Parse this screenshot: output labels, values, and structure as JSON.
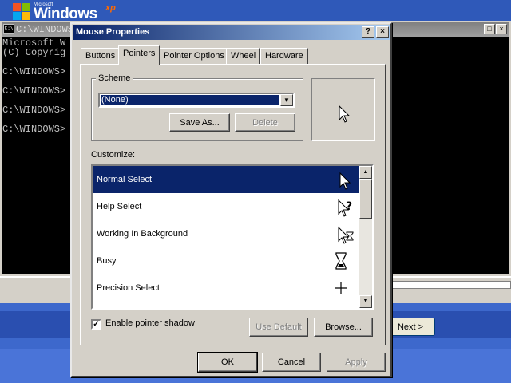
{
  "setup": {
    "logo_microsoft": "Microsoft",
    "logo_windows": "Windows",
    "logo_xp": "xp",
    "next_label": "Next >"
  },
  "cmd": {
    "title": "C:\\WINDOWS",
    "lines": [
      "Microsoft W",
      "(C) Copyrig",
      "",
      "C:\\WINDOWS>",
      "",
      "C:\\WINDOWS>",
      "",
      "C:\\WINDOWS>",
      "",
      "C:\\WINDOWS>"
    ]
  },
  "dialog": {
    "title": "Mouse Properties",
    "help_btn": "?",
    "close_btn": "×",
    "tabs": [
      {
        "label": "Buttons"
      },
      {
        "label": "Pointers"
      },
      {
        "label": "Pointer Options"
      },
      {
        "label": "Wheel"
      },
      {
        "label": "Hardware"
      }
    ],
    "active_tab": "Pointers",
    "scheme": {
      "group_label": "Scheme",
      "selected": "(None)",
      "save_as": "Save As...",
      "delete": "Delete"
    },
    "customize_label": "Customize:",
    "cursors": [
      {
        "label": "Normal Select",
        "icon": "arrow-cursor-icon"
      },
      {
        "label": "Help Select",
        "icon": "help-cursor-icon"
      },
      {
        "label": "Working In Background",
        "icon": "working-cursor-icon"
      },
      {
        "label": "Busy",
        "icon": "hourglass-icon"
      },
      {
        "label": "Precision Select",
        "icon": "crosshair-icon"
      }
    ],
    "selected_cursor": "Normal Select",
    "enable_shadow_label": "Enable pointer shadow",
    "enable_shadow_checked": true,
    "use_default": "Use Default",
    "browse": "Browse...",
    "ok": "OK",
    "cancel": "Cancel",
    "apply": "Apply"
  }
}
